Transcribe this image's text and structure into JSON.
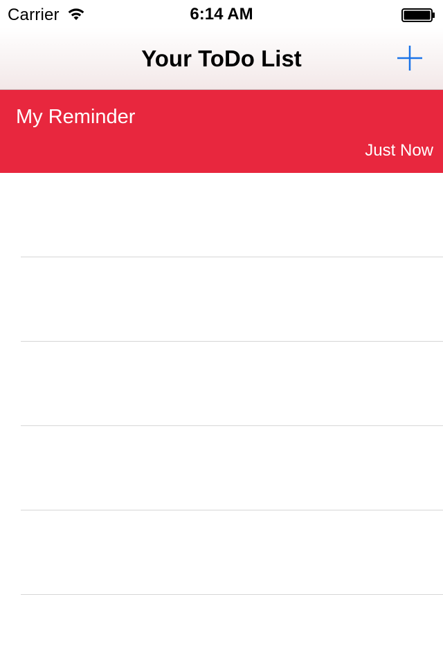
{
  "status_bar": {
    "carrier": "Carrier",
    "time": "6:14 AM",
    "wifi_icon": "wifi-icon",
    "battery_icon": "battery-icon"
  },
  "nav_bar": {
    "title": "Your ToDo List",
    "add_icon": "plus-icon",
    "accent_color": "#1a73e8"
  },
  "todo_list": {
    "highlight_color": "#e8273e",
    "items": [
      {
        "title": "My Reminder",
        "detail": "Just Now"
      }
    ],
    "empty_rows": 5
  }
}
